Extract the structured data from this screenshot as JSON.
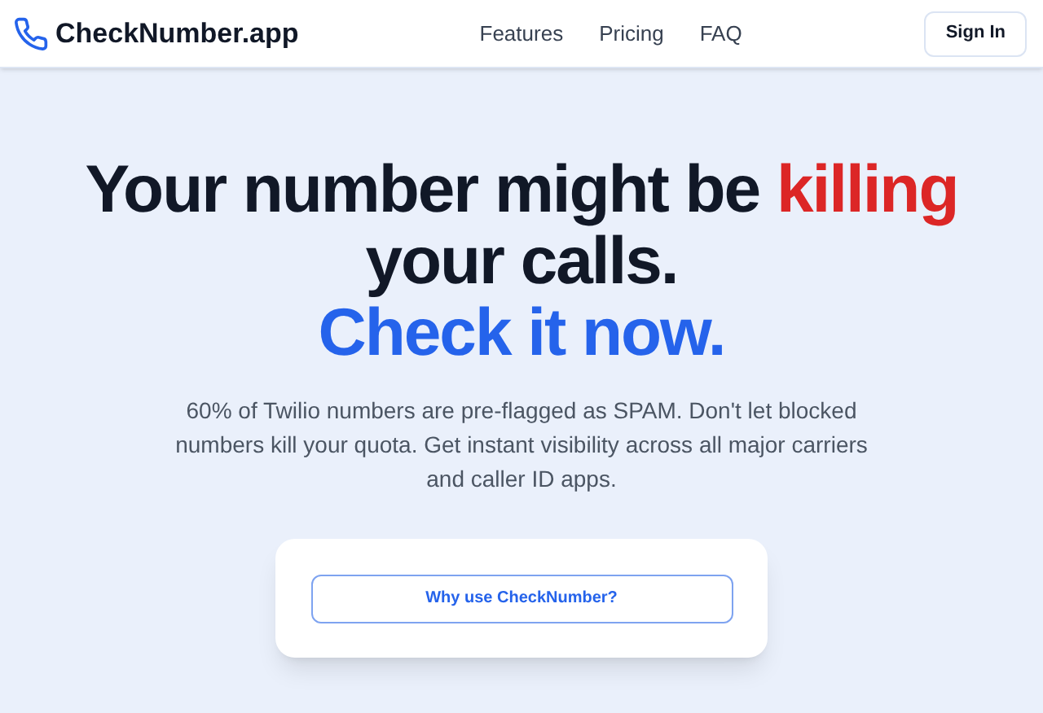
{
  "header": {
    "logo": "CheckNumber.app",
    "nav": [
      {
        "label": "Features"
      },
      {
        "label": "Pricing"
      },
      {
        "label": "FAQ"
      }
    ],
    "sign_in": "Sign In"
  },
  "hero": {
    "headline": [
      {
        "text": "Your number might be ",
        "kind": "plain"
      },
      {
        "text": "killing",
        "kind": "danger"
      },
      {
        "text": "your calls.",
        "kind": "plain"
      },
      {
        "text": "Check it now.",
        "kind": "accent"
      }
    ],
    "description": "60% of Twilio numbers are pre-flagged as SPAM. Don't let blocked numbers kill your quota. Get instant visibility across all major carriers and caller ID apps.",
    "card_button": "Why use CheckNumber?"
  }
}
